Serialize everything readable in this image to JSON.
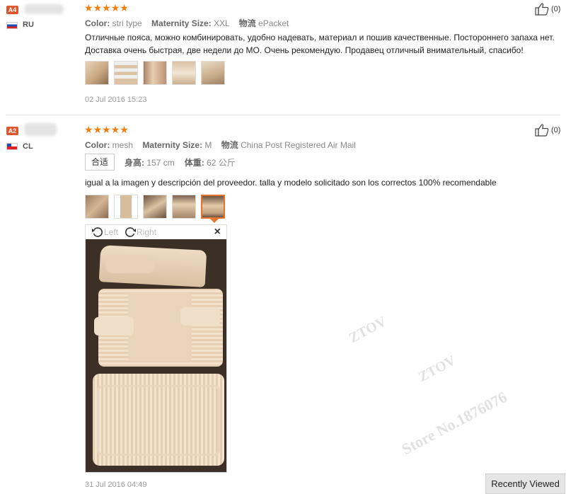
{
  "reviews": [
    {
      "level": "A4",
      "country": "RU",
      "meta": [
        {
          "label": "Color:",
          "value": "stri type"
        },
        {
          "label": "Maternity Size:",
          "value": "XXL"
        },
        {
          "label": "物流",
          "value": "ePacket"
        }
      ],
      "text_lines": [
        "Отличные пояса, можно комбинировать, удобно надевать, материал и пошив качественные. Постороннего запаха нет.",
        "Доставка очень быстрая, две недели до МО. Очень рекомендую. Продавец отличный внимательный, спасибо!"
      ],
      "date": "02 Jul 2016 15:23",
      "likes": "(0)"
    },
    {
      "level": "A2",
      "country": "CL",
      "meta": [
        {
          "label": "Color:",
          "value": "mesh"
        },
        {
          "label": "Maternity Size:",
          "value": "M"
        },
        {
          "label": "物流",
          "value": "China Post Registered Air Mail"
        }
      ],
      "fit": {
        "label": "合适",
        "height_label": "身高:",
        "height_value": "157 cm",
        "weight_label": "体重:",
        "weight_value": "62 公斤"
      },
      "text_lines": [
        "igual a la imagen y descripción del proveedor. talla y modelo solicitado son los correctos 100% recomendable"
      ],
      "viewer": {
        "left_label": "Left",
        "right_label": "Right",
        "close": "×"
      },
      "date": "31 Jul 2016 04:49",
      "likes": "(0)"
    }
  ],
  "watermarks": [
    "ZTOV",
    "ZTOV",
    "Store No.1876076"
  ],
  "recently_viewed": "Recently Viewed",
  "colors": {
    "accent": "#e0542b",
    "star": "#f07f12",
    "selected_border": "#e8732c"
  },
  "icons": {
    "rating": "star-icon",
    "like": "thumbs-up-icon",
    "rotate_left": "rotate-left-icon",
    "rotate_right": "rotate-right-icon",
    "close": "close-icon"
  }
}
